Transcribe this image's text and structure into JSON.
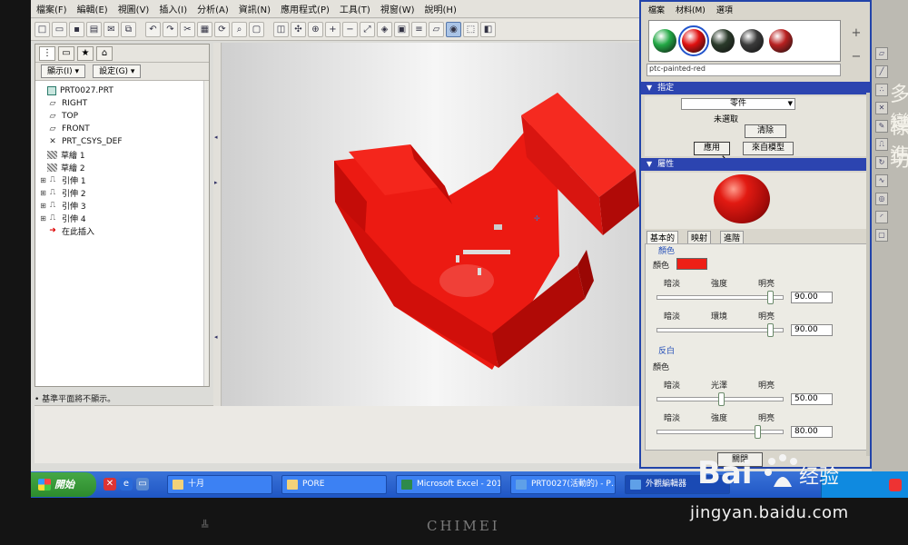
{
  "menubar": {
    "items": [
      "檔案(F)",
      "編輯(E)",
      "視圖(V)",
      "插入(I)",
      "分析(A)",
      "資訊(N)",
      "應用程式(P)",
      "工具(T)",
      "視窗(W)",
      "說明(H)"
    ]
  },
  "left_panel": {
    "dropdowns": [
      "顯示(I) ▾",
      "設定(G) ▾"
    ],
    "tree": [
      {
        "label": "PRT0027.PRT",
        "icon": "part-icon"
      },
      {
        "label": "RIGHT",
        "icon": "datum-plane-icon"
      },
      {
        "label": "TOP",
        "icon": "datum-plane-icon"
      },
      {
        "label": "FRONT",
        "icon": "datum-plane-icon"
      },
      {
        "label": "PRT_CSYS_DEF",
        "icon": "csys-icon"
      },
      {
        "label": "草繪 1",
        "icon": "sketch-icon"
      },
      {
        "label": "草繪 2",
        "icon": "sketch-icon"
      },
      {
        "label": "引伸 1",
        "icon": "extrude-icon"
      },
      {
        "label": "引伸 2",
        "icon": "extrude-icon"
      },
      {
        "label": "引伸 3",
        "icon": "extrude-icon"
      },
      {
        "label": "引伸 4",
        "icon": "extrude-icon"
      },
      {
        "label": "在此插入",
        "icon": "insert-here-icon"
      }
    ],
    "status_message": "• 基準平面將不顯示。"
  },
  "dialog": {
    "menu": [
      "檔案",
      "材料(M)",
      "選項"
    ],
    "material_name": "ptc-painted-red",
    "swatch_colors": [
      "#22a845",
      "#e01010",
      "#2a3a2a",
      "#3a3a3a",
      "#b82020"
    ],
    "assign": {
      "header": "指定",
      "target": "零件",
      "state": "未選取",
      "clear_label": "清除",
      "apply_label": "應用",
      "from_model_label": "來自模型"
    },
    "properties": {
      "header": "屬性",
      "tabs": [
        "基本的",
        "映射",
        "進階"
      ],
      "color_group": "顏色",
      "color_label": "顏色",
      "color_value": "#ee1f16",
      "row1_labels": [
        "暗淡",
        "強度",
        "明亮"
      ],
      "row1_value": "90.00",
      "row1_level": 0.9,
      "row2_labels": [
        "暗淡",
        "環境",
        "明亮"
      ],
      "row2_value": "90.00",
      "row2_level": 0.9,
      "highlight_group": "反白",
      "highlight_color_label": "顏色",
      "row3_labels": [
        "暗淡",
        "光澤",
        "明亮"
      ],
      "row3_value": "50.00",
      "row3_level": 0.5,
      "row4_labels": [
        "暗淡",
        "強度",
        "明亮"
      ],
      "row4_value": "80.00",
      "row4_level": 0.8
    },
    "close_label": "關閉"
  },
  "taskbar": {
    "start_label": "開始",
    "tasks": [
      "十月",
      "PORE",
      "Microsoft Excel - 201…",
      "PRT0027(活動的) - P…",
      "外觀編輯器"
    ]
  },
  "desktop_text": [
    "多變",
    "標準",
    "功"
  ],
  "bezel": {
    "brand": "CHIMEI"
  },
  "watermark": {
    "logo": "Bai 经验",
    "url": "jingyan.baidu.com"
  }
}
